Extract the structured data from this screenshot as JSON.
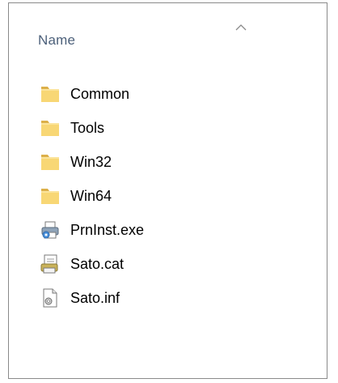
{
  "header": {
    "name_column": "Name",
    "sort_direction": "ascending"
  },
  "items": [
    {
      "label": "Common",
      "type": "folder",
      "icon": "folder-icon"
    },
    {
      "label": "Tools",
      "type": "folder",
      "icon": "folder-icon"
    },
    {
      "label": "Win32",
      "type": "folder",
      "icon": "folder-icon"
    },
    {
      "label": "Win64",
      "type": "folder",
      "icon": "folder-icon"
    },
    {
      "label": "PrnInst.exe",
      "type": "application",
      "icon": "printer-installer-icon"
    },
    {
      "label": "Sato.cat",
      "type": "security-catalog",
      "icon": "catalog-file-icon"
    },
    {
      "label": "Sato.inf",
      "type": "setup-information",
      "icon": "inf-file-icon"
    }
  ],
  "colors": {
    "header_text": "#4c607a",
    "folder": "#f8d775",
    "border": "#8a8a8a"
  }
}
